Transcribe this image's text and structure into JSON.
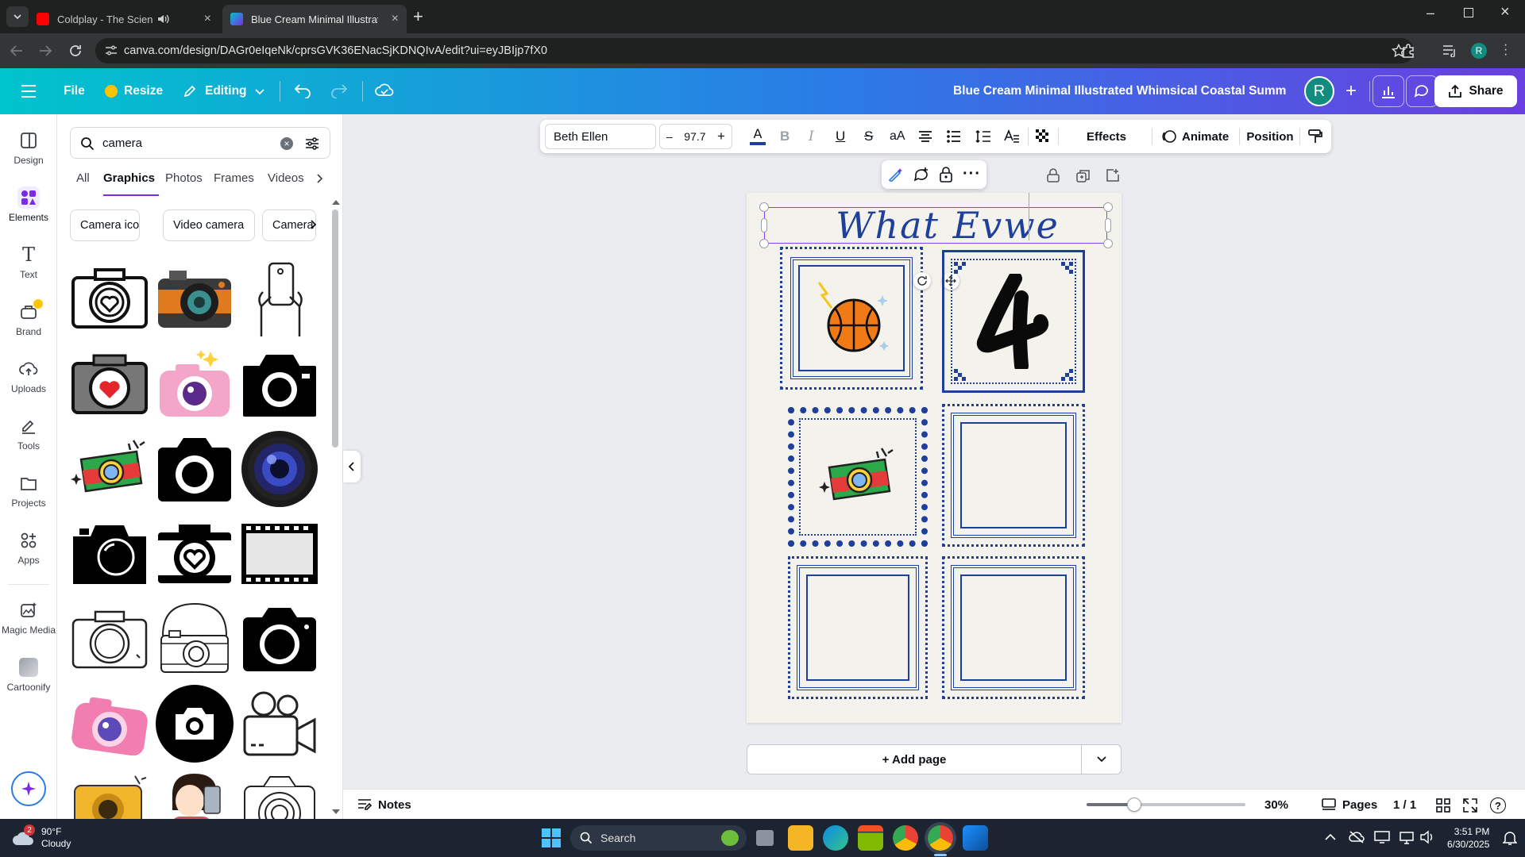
{
  "browser": {
    "tabs": [
      {
        "title": "Coldplay - The Scientist (Of",
        "active": false
      },
      {
        "title": "Blue Cream Minimal Illustrated",
        "active": true
      }
    ],
    "url": "canva.com/design/DAGr0eIqeNk/cprsGVK36ENacSjKDNQIvA/edit?ui=eyJBIjp7fX0",
    "profile_initial": "R"
  },
  "header": {
    "file": "File",
    "resize": "Resize",
    "editing": "Editing",
    "doc_title": "Blue Cream Minimal Illustrated Whimsical Coastal Summer ...",
    "avatar": "R",
    "share": "Share"
  },
  "rail": {
    "items": [
      {
        "label": "Design",
        "icon": "design-icon"
      },
      {
        "label": "Elements",
        "icon": "elements-icon"
      },
      {
        "label": "Text",
        "icon": "text-icon"
      },
      {
        "label": "Brand",
        "icon": "brand-icon"
      },
      {
        "label": "Uploads",
        "icon": "uploads-icon"
      },
      {
        "label": "Tools",
        "icon": "tools-icon"
      },
      {
        "label": "Projects",
        "icon": "projects-icon"
      },
      {
        "label": "Apps",
        "icon": "apps-icon"
      },
      {
        "label": "Magic Media",
        "icon": "magic-media-icon"
      },
      {
        "label": "Cartoonify",
        "icon": "cartoonify-icon"
      }
    ]
  },
  "panel": {
    "search_value": "camera",
    "tabs": [
      "All",
      "Graphics",
      "Photos",
      "Frames",
      "Videos"
    ],
    "active_tab": "Graphics",
    "chips": [
      "Camera icon",
      "Video camera",
      "Camera"
    ]
  },
  "toolbar": {
    "font": "Beth Ellen",
    "minus": "–",
    "size": "97.7",
    "plus": "+",
    "effects": "Effects",
    "animate": "Animate",
    "position": "Position"
  },
  "canvas": {
    "heading": "What Evwe",
    "add_page": "+ Add page"
  },
  "footer": {
    "notes": "Notes",
    "zoom": "30%",
    "zoom_level": 0.3,
    "pages": "Pages",
    "page_count": "1 / 1"
  },
  "taskbar": {
    "weather_temp": "90°F",
    "weather_desc": "Cloudy",
    "weather_badge": "2",
    "search": "Search",
    "time": "3:51 PM",
    "date": "6/30/2025"
  },
  "colors": {
    "accent": "#8b3dff",
    "frame_blue": "#1e3f9a",
    "header_start": "#00c4cc",
    "header_end": "#6a3fe0"
  }
}
